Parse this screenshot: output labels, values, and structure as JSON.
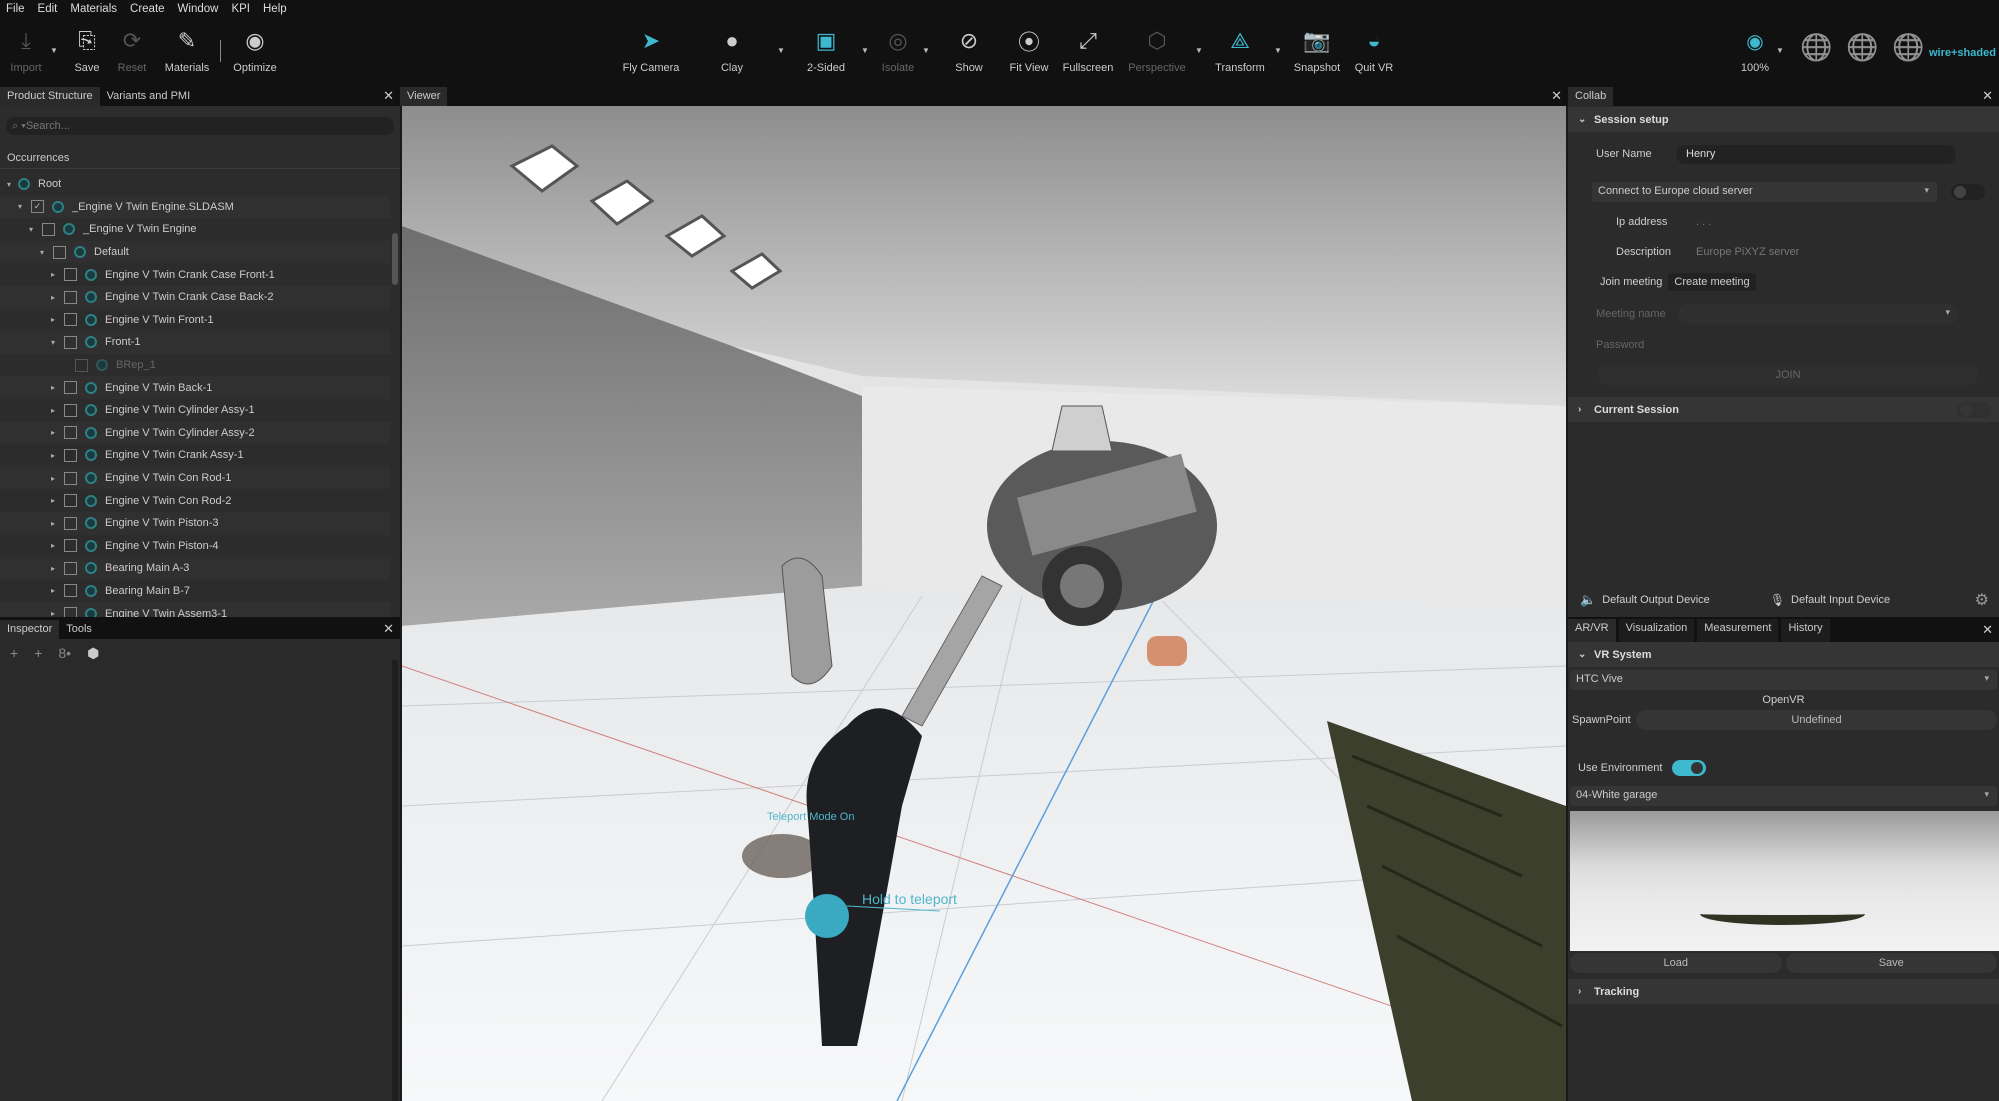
{
  "menu": [
    "File",
    "Edit",
    "Materials",
    "Create",
    "Window",
    "KPI",
    "Help"
  ],
  "toolbar": {
    "left": [
      {
        "label": "Import",
        "icon": "import-icon",
        "disabled": true
      },
      {
        "label": "Save",
        "icon": "save-icon"
      },
      {
        "label": "Reset",
        "icon": "reset-icon",
        "disabled": true
      },
      {
        "label": "Materials",
        "icon": "materials-icon"
      },
      {
        "label": "Optimize",
        "icon": "optimize-icon"
      }
    ],
    "center": [
      {
        "label": "Fly Camera"
      },
      {
        "label": "Clay"
      },
      {
        "label": "2-Sided"
      },
      {
        "label": "Isolate",
        "disabled": true
      },
      {
        "label": "Show"
      },
      {
        "label": "Fit View"
      },
      {
        "label": "Fullscreen"
      },
      {
        "label": "Perspective",
        "disabled": true
      },
      {
        "label": "Transform"
      },
      {
        "label": "Snapshot"
      },
      {
        "label": "Quit VR"
      }
    ],
    "zoom": "100%",
    "render_mode": "wire+shaded",
    "accent": "#3db8cf"
  },
  "left_panel": {
    "tabs": [
      "Product Structure",
      "Variants and PMI"
    ],
    "search_placeholder": "Search...",
    "header": "Occurrences",
    "tree": [
      {
        "label": "Root",
        "level": 0,
        "open": true,
        "nocb": true
      },
      {
        "label": "_Engine V Twin Engine.SLDASM",
        "level": 1,
        "open": true,
        "checked": true
      },
      {
        "label": "_Engine V Twin Engine",
        "level": 2,
        "open": true
      },
      {
        "label": "Default",
        "level": 3,
        "open": true
      },
      {
        "label": "Engine V Twin Crank Case Front-1",
        "level": 4
      },
      {
        "label": "Engine V Twin Crank Case Back-2",
        "level": 4
      },
      {
        "label": "Engine V Twin Front-1",
        "level": 4
      },
      {
        "label": "Front-1",
        "level": 4,
        "open": true
      },
      {
        "label": "BRep_1",
        "level": 5,
        "leaf": true,
        "dim": true
      },
      {
        "label": "Engine V Twin Back-1",
        "level": 4
      },
      {
        "label": "Engine V Twin Cylinder Assy-1",
        "level": 4
      },
      {
        "label": "Engine V Twin Cylinder Assy-2",
        "level": 4
      },
      {
        "label": "Engine V Twin Crank Assy-1",
        "level": 4
      },
      {
        "label": "Engine V Twin Con Rod-1",
        "level": 4
      },
      {
        "label": "Engine V Twin Con Rod-2",
        "level": 4
      },
      {
        "label": "Engine V Twin Piston-3",
        "level": 4
      },
      {
        "label": "Engine V Twin Piston-4",
        "level": 4
      },
      {
        "label": "Bearing Main A-3",
        "level": 4
      },
      {
        "label": "Bearing Main B-7",
        "level": 4
      },
      {
        "label": "Engine V Twin Assem3-1",
        "level": 4
      }
    ]
  },
  "inspector": {
    "tabs": [
      "Inspector",
      "Tools"
    ]
  },
  "viewer": {
    "title": "Viewer",
    "teleport_mode": "Teleport Mode On",
    "hold_hint": "Hold to teleport"
  },
  "collab": {
    "title": "Collab",
    "session_setup": "Session setup",
    "user_name_label": "User Name",
    "user_name": "Henry",
    "server": "Connect to Europe cloud server",
    "ip_label": "Ip address",
    "ip_value": ". . .",
    "description_label": "Description",
    "description": "Europe PiXYZ server",
    "join_tab": "Join meeting",
    "create_tab": "Create meeting",
    "meeting_name_label": "Meeting name",
    "password_label": "Password",
    "join_button": "JOIN",
    "current_session": "Current Session",
    "output_device": "Default Output Device",
    "input_device": "Default Input Device"
  },
  "arvr": {
    "tabs": [
      "AR/VR",
      "Visualization",
      "Measurement",
      "History"
    ],
    "vr_system": "VR System",
    "device": "HTC Vive",
    "runtime": "OpenVR",
    "spawn_label": "SpawnPoint",
    "spawn_value": "Undefined",
    "use_env_label": "Use Environment",
    "use_env": true,
    "environment": "04-White garage",
    "load": "Load",
    "save": "Save",
    "tracking": "Tracking"
  }
}
